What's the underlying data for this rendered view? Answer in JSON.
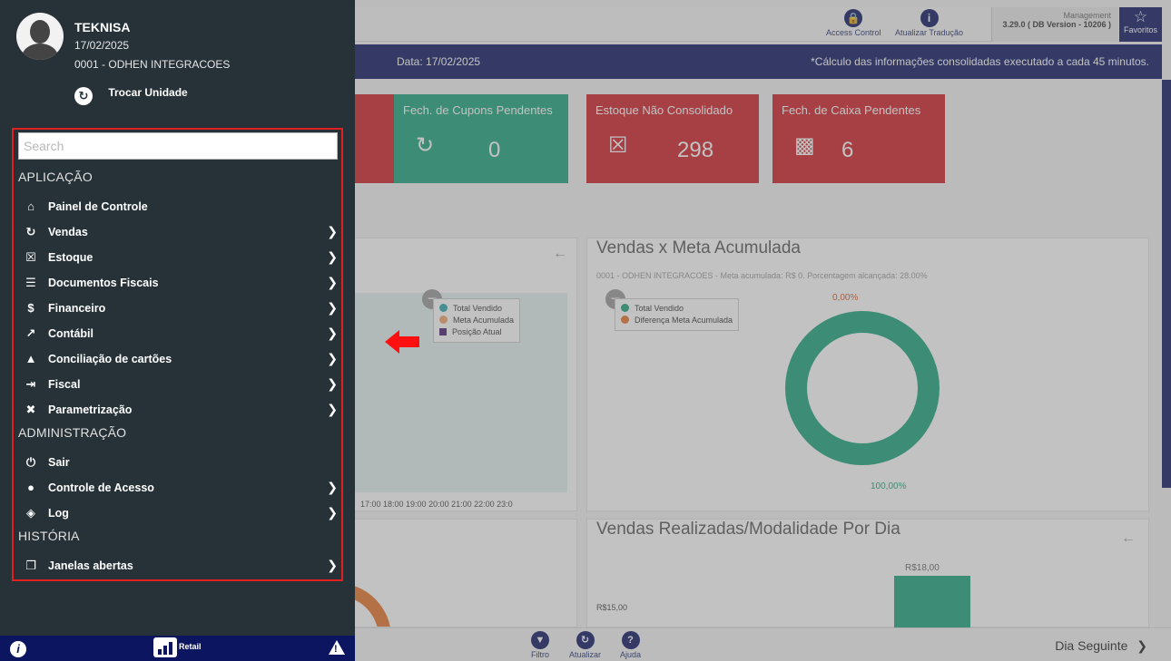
{
  "user": {
    "name": "TEKNISA",
    "date": "17/02/2025",
    "unit": "0001 - ODHEN INTEGRACOES",
    "switch_unit_label": "Trocar Unidade"
  },
  "search": {
    "placeholder": "Search"
  },
  "menu": {
    "sections": [
      {
        "title": "APLICAÇÃO",
        "items": [
          {
            "label": "Painel de Controle",
            "icon": "home-icon",
            "has_submenu": false
          },
          {
            "label": "Vendas",
            "icon": "sales-icon",
            "has_submenu": true
          },
          {
            "label": "Estoque",
            "icon": "inventory-icon",
            "has_submenu": true
          },
          {
            "label": "Documentos Fiscais",
            "icon": "documents-icon",
            "has_submenu": true
          },
          {
            "label": "Financeiro",
            "icon": "dollar-icon",
            "has_submenu": true
          },
          {
            "label": "Contábil",
            "icon": "chart-line-icon",
            "has_submenu": true
          },
          {
            "label": "Conciliação de cartões",
            "icon": "money-bag-icon",
            "has_submenu": true
          },
          {
            "label": "Fiscal",
            "icon": "export-icon",
            "has_submenu": true
          },
          {
            "label": "Parametrização",
            "icon": "tools-icon",
            "has_submenu": true
          }
        ]
      },
      {
        "title": "ADMINISTRAÇÃO",
        "items": [
          {
            "label": "Sair",
            "icon": "power-icon",
            "has_submenu": false
          },
          {
            "label": "Controle de Acesso",
            "icon": "user-icon",
            "has_submenu": true
          },
          {
            "label": "Log",
            "icon": "layers-icon",
            "has_submenu": true
          }
        ]
      },
      {
        "title": "HISTÓRIA",
        "items": [
          {
            "label": "Janelas abertas",
            "icon": "windows-icon",
            "has_submenu": true
          }
        ]
      }
    ]
  },
  "footer": {
    "logo_text": "Retail"
  },
  "topbar": {
    "access_control": "Access Control",
    "update_translation": "Atualizar Tradução",
    "management_label": "Management",
    "version": "3.29.0 ( DB Version - 10206 )",
    "favorites": "Favoritos"
  },
  "infobar": {
    "date": "Data: 17/02/2025",
    "note": "*Cálculo das informações consolidadas executado a cada 45 minutos."
  },
  "cards": [
    {
      "title": "Fech. de Cupons Pendentes",
      "value": "0",
      "color": "#1aa37a"
    },
    {
      "title": "Estoque Não Consolidado",
      "value": "298",
      "color": "#d01f26"
    },
    {
      "title": "Fech. de Caixa Pendentes",
      "value": "6",
      "color": "#d01f26"
    }
  ],
  "line_chart": {
    "legend": [
      "Total Vendido",
      "Meta Acumulada",
      "Posição Atual"
    ],
    "x_labels": "17:00  18:00  19:00  20:00  21:00  22:00  23:0"
  },
  "donut_chart": {
    "title": "Vendas x Meta Acumulada",
    "subtitle": "0001 - ODHEN INTEGRACOES - Meta acumulada: R$ 0. Porcentagem alcançada: 28.00%",
    "legend": [
      "Total Vendido",
      "Diferença Meta Acumulada"
    ],
    "label_top": "0,00%",
    "label_bottom": "100,00%"
  },
  "bar_chart": {
    "title": "Vendas Realizadas/Modalidade Por Dia",
    "bar_label": "R$18,00",
    "tick": "R$15,00"
  },
  "bottombar": {
    "filter": "Filtro",
    "refresh": "Atualizar",
    "help": "Ajuda",
    "next_day": "Dia Seguinte"
  },
  "colors": {
    "sidebar": "#263238",
    "navy": "#0c1660",
    "green": "#1aa37a",
    "red": "#d01f26",
    "highlight": "#e01f1f"
  }
}
